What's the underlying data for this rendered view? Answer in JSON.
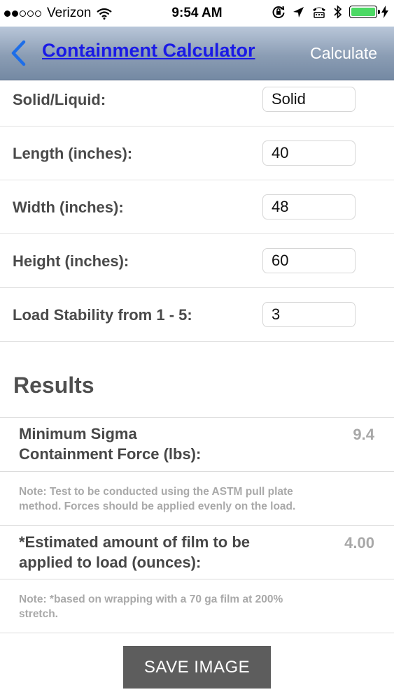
{
  "status_bar": {
    "carrier": "Verizon",
    "time": "9:54 AM",
    "signal_bars_filled": 2,
    "signal_bars_total": 5,
    "battery_color": "#4cd964"
  },
  "nav": {
    "back_icon": "chevron-left-icon",
    "title": "Containment Calculator",
    "action_label": "Calculate",
    "title_color": "#1a1ae6"
  },
  "form": {
    "rows": [
      {
        "label": "Solid/Liquid:",
        "value": "Solid"
      },
      {
        "label": "Length (inches):",
        "value": "40"
      },
      {
        "label": "Width (inches):",
        "value": "48"
      },
      {
        "label": "Height (inches):",
        "value": "60"
      },
      {
        "label": "Load Stability from 1 - 5:",
        "value": "3"
      }
    ]
  },
  "results": {
    "heading": "Results",
    "force_label_line1": "Minimum Sigma",
    "force_label_line2": "Containment Force (lbs):",
    "force_value": "9.4",
    "force_note_line1": "Note: Test to be conducted using the ASTM pull plate",
    "force_note_line2": "method. Forces should be applied evenly on the load.",
    "film_label_line1": "*Estimated amount of film to be",
    "film_label_line2": "applied to load (ounces):",
    "film_value": "4.00",
    "film_note_line1": "Note: *based on wrapping with a 70 ga film at 200%",
    "film_note_line2": "stretch."
  },
  "save_button_label": "SAVE IMAGE"
}
